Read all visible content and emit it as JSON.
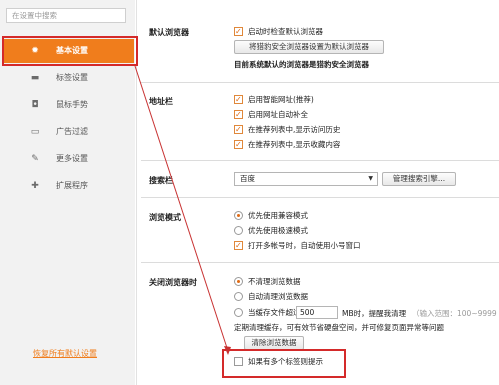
{
  "sidebar": {
    "search_placeholder": "在设置中搜索",
    "items": [
      {
        "label": "基本设置",
        "icon": "gear-icon"
      },
      {
        "label": "标签设置",
        "icon": "tab-icon"
      },
      {
        "label": "鼠标手势",
        "icon": "mouse-icon"
      },
      {
        "label": "广告过滤",
        "icon": "ad-filter-icon"
      },
      {
        "label": "更多设置",
        "icon": "wrench-icon"
      },
      {
        "label": "扩展程序",
        "icon": "puzzle-icon"
      }
    ],
    "restore_label": "恢复所有默认设置"
  },
  "default_browser": {
    "title": "默认浏览器",
    "check_on_start": "启动时检查默认浏览器",
    "set_default_button": "将猎豹安全浏览器设置为默认浏览器",
    "status": "目前系统默认的浏览器是猎豹安全浏览器"
  },
  "address_bar": {
    "title": "地址栏",
    "options": [
      "启用智能网址(推荐)",
      "启用网址自动补全",
      "在推荐列表中,显示访问历史",
      "在推荐列表中,显示收藏内容"
    ]
  },
  "search_bar": {
    "title": "搜索栏",
    "engine": "百度",
    "manage_button": "管理搜索引擎..."
  },
  "browse_mode": {
    "title": "浏览模式",
    "options": [
      "优先使用兼容模式",
      "优先使用极速模式"
    ],
    "multi_account": "打开多帐号时，自动使用小号窗口"
  },
  "close_browser": {
    "title": "关闭浏览器时",
    "options": [
      "不清理浏览数据",
      "自动清理浏览数据"
    ],
    "cache_prefix": "当缓存文件超过",
    "cache_value": "500",
    "cache_suffix": "MB时，提醒我清理",
    "cache_hint": "（输入范围：100~9999",
    "cache_note": "定期清理缓存，可有效节省硬盘空间，并可修复页面异常等问题",
    "clear_button": "清除浏览数据",
    "multi_tab_prompt": "如果有多个标签则提示"
  }
}
